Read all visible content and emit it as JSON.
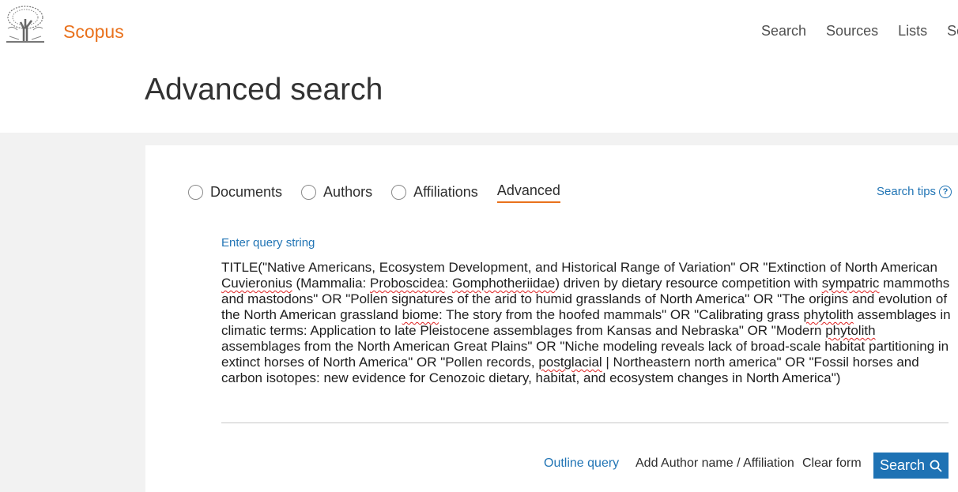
{
  "header": {
    "brand": "Scopus",
    "nav": [
      "Search",
      "Sources",
      "Lists",
      "Sci"
    ]
  },
  "page": {
    "title": "Advanced search"
  },
  "tabs": {
    "documents": "Documents",
    "authors": "Authors",
    "affiliations": "Affiliations",
    "advanced": "Advanced"
  },
  "search_tips": "Search tips",
  "query": {
    "label": "Enter query string",
    "segments": [
      "TITLE(\"Native Americans, Ecosystem Development, and Historical Range of Variation\" OR \"Extinction of North American ",
      "Cuvieronius",
      " (Mammalia: ",
      "Proboscidea",
      ": ",
      "Gomphotheriidae",
      ") driven by dietary resource competition with ",
      "sympatric",
      " mammoths and mastodons\" OR \"Pollen signatures of the arid to humid grasslands of North America\" OR \"The origins and evolution of the North American grassland ",
      "biome",
      ": The story from the hoofed mammals\" OR \"Calibrating grass ",
      "phytolith",
      " assemblages in climatic terms: Application to late Pleistocene assemblages from Kansas and Nebraska\" OR \"Modern ",
      "phytolith",
      " assemblages from the North American Great Plains\" OR \"Niche modeling reveals lack of broad-scale habitat partitioning in extinct horses of North America\" OR \"Pollen records, ",
      "postglacial",
      " | Northeastern north america\" OR \"Fossil horses and carbon isotopes: new evidence for Cenozoic dietary, habitat, and ecosystem changes in North America\")"
    ]
  },
  "actions": {
    "outline": "Outline query",
    "add_author": "Add Author name / Affiliation",
    "clear": "Clear form",
    "search": "Search"
  },
  "colors": {
    "brand": "#e9711c",
    "link": "#2275b5",
    "button": "#1e72b4"
  }
}
